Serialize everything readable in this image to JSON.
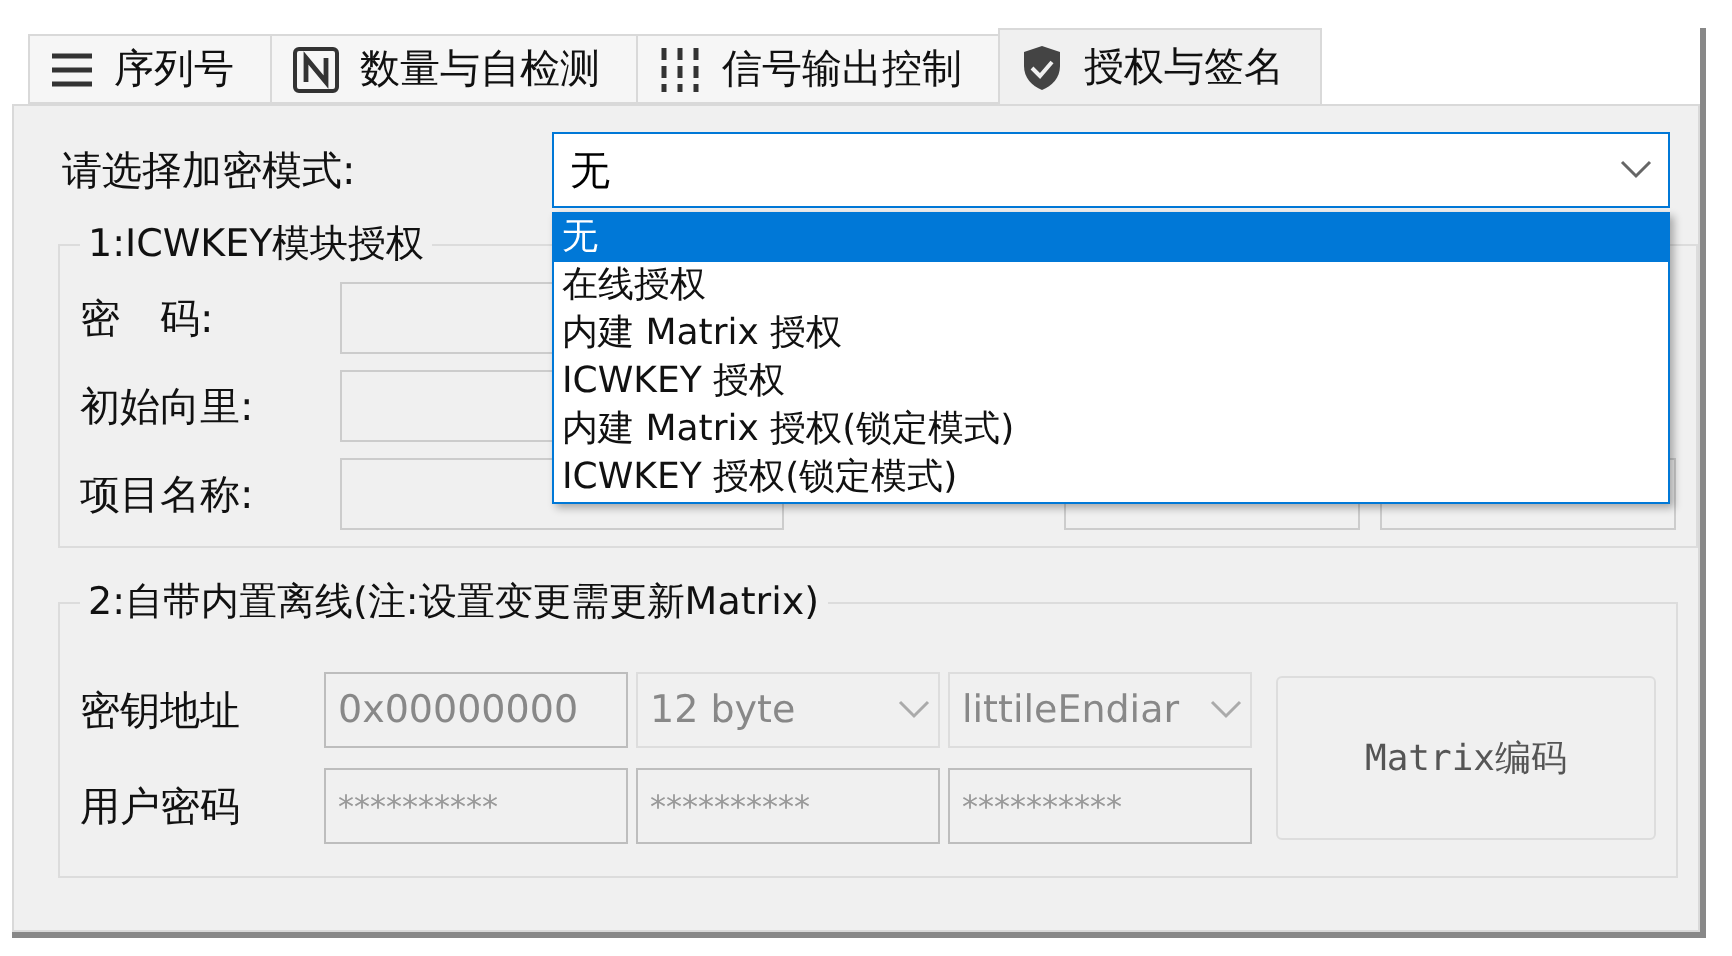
{
  "tabs": [
    {
      "label": "序列号",
      "selected": false
    },
    {
      "label": "数量与自检测",
      "selected": false
    },
    {
      "label": "信号输出控制",
      "selected": false
    },
    {
      "label": "授权与签名",
      "selected": true
    }
  ],
  "mode": {
    "label": "请选择加密模式:",
    "value": "无",
    "expanded": true,
    "options": [
      {
        "label": "无",
        "selected": true
      },
      {
        "label": "在线授权",
        "selected": false
      },
      {
        "label": "内建 Matrix 授权",
        "selected": false
      },
      {
        "label": "ICWKEY 授权",
        "selected": false
      },
      {
        "label": "内建 Matrix 授权(锁定模式)",
        "selected": false
      },
      {
        "label": "ICWKEY 授权(锁定模式)",
        "selected": false
      }
    ]
  },
  "group1": {
    "title": "1:ICWKEY模块授权",
    "rows": [
      {
        "label": "密　码:"
      },
      {
        "label": "初始向里:"
      },
      {
        "label": "项目名称:"
      }
    ]
  },
  "group2": {
    "title": "2:自带内置离线(注:设置变更需更新Matrix)",
    "key_row": {
      "label": "密钥地址",
      "address": "0x00000000",
      "size": "12 byte",
      "endian": "littileEndiar"
    },
    "password_row": {
      "label": "用户密码",
      "values": [
        "**********",
        "**********",
        "**********"
      ]
    },
    "encode_button": "Matrix编码"
  }
}
